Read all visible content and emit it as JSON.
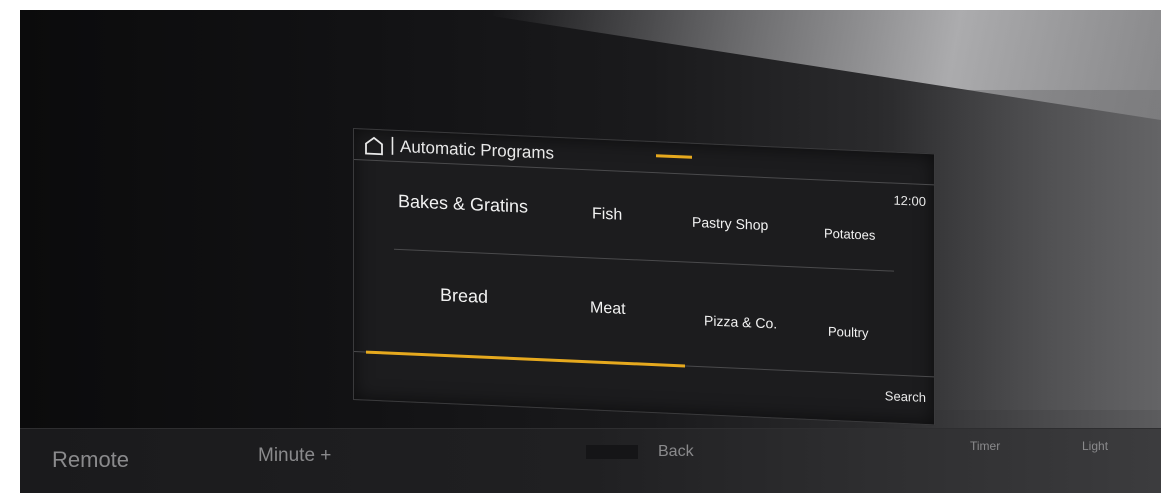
{
  "screen": {
    "title": "Automatic Programs",
    "separator": "|",
    "clock": "12:00",
    "search_label": "Search",
    "tiles": [
      {
        "label": "Bakes & Gratins"
      },
      {
        "label": "Fish"
      },
      {
        "label": "Pastry Shop"
      },
      {
        "label": "Potatoes"
      },
      {
        "label": "Bread"
      },
      {
        "label": "Meat"
      },
      {
        "label": "Pizza & Co."
      },
      {
        "label": "Poultry"
      }
    ],
    "scroll_progress": 0.55,
    "accent_color": "#e6a91e"
  },
  "controls": {
    "remote": "Remote",
    "minute_plus": "Minute +",
    "back": "Back",
    "timer": "Timer",
    "light": "Light"
  }
}
